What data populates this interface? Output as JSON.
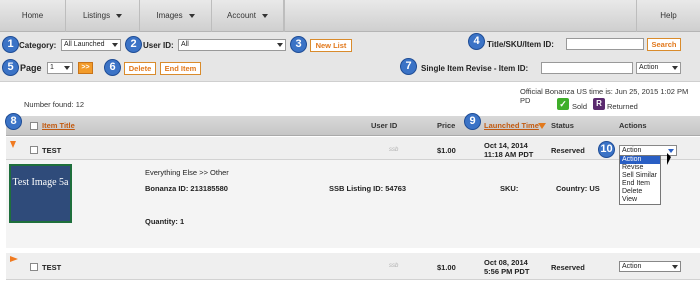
{
  "nav": {
    "items": [
      {
        "label": "Home"
      },
      {
        "label": "Listings"
      },
      {
        "label": "Images"
      },
      {
        "label": "Account"
      },
      {
        "label": "Help"
      }
    ]
  },
  "badges": [
    "1",
    "2",
    "3",
    "4",
    "5",
    "6",
    "7",
    "8",
    "9",
    "10"
  ],
  "filters": {
    "category_label": "Category:",
    "category_value": "All Launched",
    "userid_label": "User ID:",
    "userid_value": "All",
    "new_list_button": "New List",
    "title_sku_label": "Title/SKU/Item ID:",
    "search_button": "Search",
    "page_label": "Page",
    "page_value": "1",
    "next_button": ">>",
    "delete_button": "Delete",
    "end_item_button": "End Item",
    "single_revise_label": "Single Item Revise - Item ID:",
    "single_revise_action": "Action"
  },
  "info": {
    "number_found": "Number found: 12",
    "time_note": "Official Bonanza US time is: Jun 25, 2015 1:02 PM PD",
    "legend_sold": "Sold",
    "legend_returned": "Returned"
  },
  "table": {
    "headers": {
      "item_title": "Item Title",
      "user_id": "User ID",
      "price": "Price",
      "launched_time": "Launched Time",
      "status": "Status",
      "actions": "Actions"
    },
    "rows": [
      {
        "title": "TEST",
        "user_id": "ssb",
        "price": "$1.00",
        "launched_line1": "Oct 14, 2014",
        "launched_line2": "11:18 AM PDT",
        "status": "Reserved",
        "action": "Action"
      },
      {
        "title": "TEST",
        "user_id": "ssb",
        "price": "$1.00",
        "launched_line1": "Oct 08, 2014",
        "launched_line2": "5:56 PM PDT",
        "status": "Reserved",
        "action": "Action"
      }
    ],
    "detail": {
      "thumb_text": "Test Image 5a",
      "category_path": "Everything Else >> Other",
      "bonanza_id": "Bonanza ID: 213185580",
      "ssb_listing_id": "SSB Listing ID: 54763",
      "sku": "SKU:",
      "country": "Country: US",
      "quantity": "Quantity: 1"
    },
    "action_menu": [
      "Action",
      "Revise",
      "Sell Similar",
      "End Item",
      "Delete",
      "View"
    ]
  },
  "colors": {
    "badge": "#3b73c6",
    "orange": "#e2791c",
    "link": "#c25a10"
  }
}
